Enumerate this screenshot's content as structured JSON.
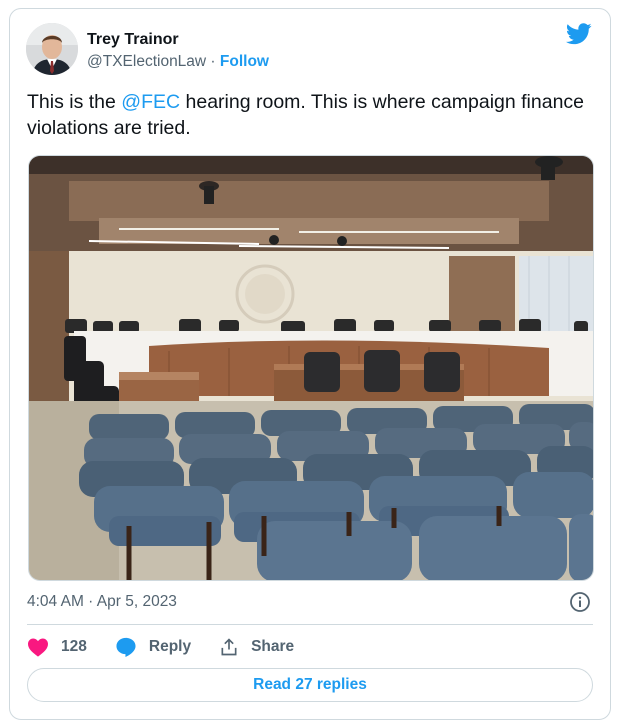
{
  "author": {
    "name": "Trey Trainor",
    "handle": "@TXElectionLaw",
    "separator": " · ",
    "follow_label": "Follow"
  },
  "tweet": {
    "text_before": "This is the ",
    "mention": "@FEC",
    "text_after": " hearing room. This is where campaign finance violations are tried."
  },
  "media": {
    "description_icon": "photo"
  },
  "meta": {
    "timestamp": "4:04 AM · Apr 5, 2023"
  },
  "actions": {
    "like_count": "128",
    "reply_label": "Reply",
    "share_label": "Share"
  },
  "read_replies_label": "Read 27 replies",
  "colors": {
    "brand": "#1d9bf0",
    "like": "#f91880",
    "text": "#0f1419",
    "muted": "#536471",
    "border": "#cfd9de"
  }
}
